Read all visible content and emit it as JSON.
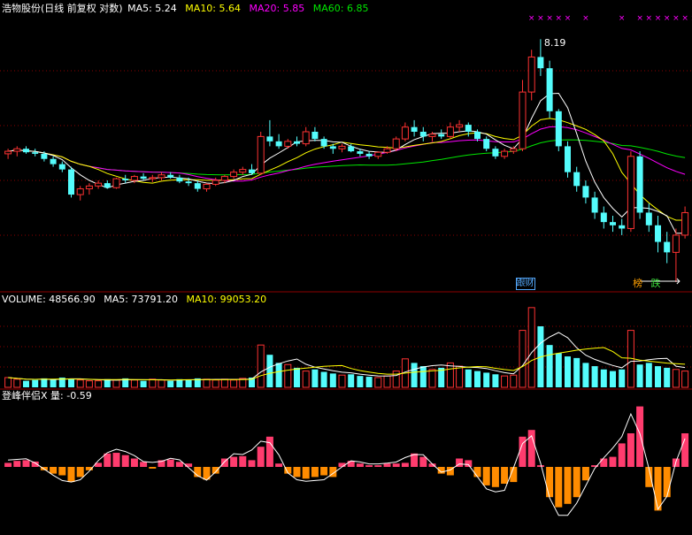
{
  "colors": {
    "background": "#000000",
    "grid": "#8b0000",
    "up": "#ff3232",
    "down": "#54fcfc",
    "text": "#ffffff",
    "ma5": "#ffffff",
    "ma10": "#ffff00",
    "ma20": "#ff00ff",
    "ma60": "#00e600",
    "bar_pos": "#ff3c6e",
    "bar_neg": "#ff8c00",
    "marker_cyan": "#54a8fc",
    "marker_orange": "#ffa000",
    "marker_green": "#3cdc3c",
    "marker_pink": "#ff00ff"
  },
  "price_panel": {
    "title": "浩物股份(日线 前复权 对数)",
    "ma_labels": [
      {
        "key": "MA5",
        "text": "MA5: 5.24"
      },
      {
        "key": "MA10",
        "text": "MA10: 5.64"
      },
      {
        "key": "MA20",
        "text": "MA20: 5.85"
      },
      {
        "key": "MA60",
        "text": "MA60: 6.85"
      }
    ],
    "peak_label": "8.19",
    "markers": [
      {
        "text": "跟财",
        "day": 57
      },
      {
        "text": "榜",
        "day": 70
      },
      {
        "text": "跌",
        "day": 72
      }
    ],
    "pink_x_days": [
      58,
      59,
      60,
      61,
      62,
      64,
      68,
      70,
      71,
      72,
      73,
      74,
      75,
      76,
      77
    ]
  },
  "volume_panel": {
    "labels": [
      {
        "key": "VOLUME",
        "text": "VOLUME: 48566.90"
      },
      {
        "key": "MA5",
        "text": "MA5: 73791.20"
      },
      {
        "key": "MA10",
        "text": "MA10: 99053.20"
      }
    ]
  },
  "indicator_panel": {
    "label": "登峰伴侣X 量: -0.59"
  },
  "chart_data": {
    "type": "candlestick",
    "candles": [
      [
        5.85,
        5.95,
        5.75,
        5.9
      ],
      [
        5.9,
        6.0,
        5.8,
        5.95
      ],
      [
        5.95,
        6.0,
        5.85,
        5.88
      ],
      [
        5.88,
        5.95,
        5.8,
        5.85
      ],
      [
        5.85,
        5.9,
        5.7,
        5.75
      ],
      [
        5.75,
        5.8,
        5.6,
        5.65
      ],
      [
        5.65,
        5.7,
        5.5,
        5.55
      ],
      [
        5.55,
        5.6,
        5.05,
        5.1
      ],
      [
        5.1,
        5.25,
        5.0,
        5.2
      ],
      [
        5.2,
        5.3,
        5.1,
        5.25
      ],
      [
        5.25,
        5.35,
        5.2,
        5.3
      ],
      [
        5.3,
        5.35,
        5.2,
        5.22
      ],
      [
        5.22,
        5.4,
        5.2,
        5.38
      ],
      [
        5.38,
        5.45,
        5.3,
        5.35
      ],
      [
        5.35,
        5.45,
        5.3,
        5.42
      ],
      [
        5.42,
        5.48,
        5.35,
        5.38
      ],
      [
        5.38,
        5.45,
        5.32,
        5.4
      ],
      [
        5.4,
        5.5,
        5.35,
        5.45
      ],
      [
        5.45,
        5.5,
        5.38,
        5.4
      ],
      [
        5.4,
        5.45,
        5.3,
        5.33
      ],
      [
        5.33,
        5.4,
        5.25,
        5.3
      ],
      [
        5.3,
        5.35,
        5.15,
        5.2
      ],
      [
        5.2,
        5.3,
        5.15,
        5.28
      ],
      [
        5.28,
        5.4,
        5.25,
        5.35
      ],
      [
        5.35,
        5.45,
        5.3,
        5.42
      ],
      [
        5.42,
        5.55,
        5.38,
        5.5
      ],
      [
        5.5,
        5.6,
        5.45,
        5.55
      ],
      [
        5.55,
        5.65,
        5.45,
        5.48
      ],
      [
        5.48,
        6.3,
        5.45,
        6.2
      ],
      [
        6.2,
        6.55,
        6.0,
        6.1
      ],
      [
        6.1,
        6.25,
        5.95,
        6.0
      ],
      [
        6.0,
        6.15,
        5.95,
        6.1
      ],
      [
        6.1,
        6.2,
        6.0,
        6.05
      ],
      [
        6.05,
        6.4,
        6.0,
        6.3
      ],
      [
        6.3,
        6.4,
        6.1,
        6.15
      ],
      [
        6.15,
        6.2,
        5.95,
        6.0
      ],
      [
        6.0,
        6.05,
        5.85,
        5.95
      ],
      [
        5.95,
        6.05,
        5.88,
        6.0
      ],
      [
        6.0,
        6.05,
        5.88,
        5.9
      ],
      [
        5.9,
        5.95,
        5.8,
        5.85
      ],
      [
        5.85,
        5.9,
        5.75,
        5.8
      ],
      [
        5.8,
        5.9,
        5.75,
        5.88
      ],
      [
        5.88,
        6.0,
        5.85,
        5.95
      ],
      [
        5.95,
        6.2,
        5.9,
        6.15
      ],
      [
        6.15,
        6.5,
        6.1,
        6.4
      ],
      [
        6.4,
        6.55,
        6.2,
        6.3
      ],
      [
        6.3,
        6.4,
        6.1,
        6.2
      ],
      [
        6.2,
        6.3,
        6.1,
        6.25
      ],
      [
        6.25,
        6.35,
        6.15,
        6.2
      ],
      [
        6.2,
        6.5,
        6.15,
        6.4
      ],
      [
        6.4,
        6.55,
        6.3,
        6.45
      ],
      [
        6.45,
        6.5,
        6.2,
        6.3
      ],
      [
        6.3,
        6.35,
        6.1,
        6.15
      ],
      [
        6.15,
        6.2,
        5.9,
        5.95
      ],
      [
        5.95,
        6.0,
        5.75,
        5.8
      ],
      [
        5.8,
        5.95,
        5.75,
        5.9
      ],
      [
        5.9,
        6.0,
        5.85,
        5.95
      ],
      [
        5.95,
        7.5,
        5.9,
        7.2
      ],
      [
        7.2,
        8.3,
        7.0,
        8.1
      ],
      [
        8.1,
        8.6,
        7.6,
        7.8
      ],
      [
        7.8,
        8.0,
        6.6,
        6.75
      ],
      [
        6.75,
        6.8,
        5.9,
        6.0
      ],
      [
        6.0,
        6.1,
        5.4,
        5.5
      ],
      [
        5.5,
        5.6,
        5.15,
        5.25
      ],
      [
        5.25,
        5.35,
        4.95,
        5.05
      ],
      [
        5.05,
        5.15,
        4.7,
        4.8
      ],
      [
        4.8,
        4.9,
        4.55,
        4.65
      ],
      [
        4.65,
        4.75,
        4.5,
        4.6
      ],
      [
        4.6,
        4.7,
        4.45,
        4.55
      ],
      [
        4.55,
        5.9,
        4.5,
        5.8
      ],
      [
        5.8,
        5.9,
        4.7,
        4.8
      ],
      [
        4.8,
        4.95,
        4.5,
        4.6
      ],
      [
        4.6,
        4.75,
        4.2,
        4.35
      ],
      [
        4.35,
        4.5,
        4.05,
        4.2
      ],
      [
        4.2,
        4.55,
        3.8,
        4.45
      ],
      [
        4.45,
        4.9,
        4.4,
        4.8
      ]
    ],
    "volume": [
      12,
      10,
      8,
      9,
      11,
      10,
      12,
      10,
      9,
      8,
      8,
      10,
      9,
      11,
      9,
      8,
      10,
      9,
      8,
      10,
      9,
      11,
      10,
      9,
      10,
      9,
      11,
      12,
      52,
      40,
      30,
      28,
      24,
      20,
      22,
      19,
      17,
      15,
      16,
      14,
      13,
      12,
      14,
      20,
      35,
      30,
      26,
      22,
      24,
      30,
      26,
      22,
      20,
      18,
      16,
      14,
      15,
      70,
      98,
      75,
      52,
      42,
      38,
      36,
      30,
      26,
      22,
      20,
      22,
      70,
      28,
      30,
      26,
      24,
      22,
      20
    ],
    "indicator": [
      0.12,
      0.18,
      0.2,
      0.16,
      -0.1,
      -0.2,
      -0.25,
      -0.45,
      -0.3,
      -0.1,
      0.12,
      0.4,
      0.42,
      0.35,
      0.25,
      0.15,
      -0.05,
      0.2,
      0.22,
      0.15,
      0.1,
      -0.3,
      -0.38,
      -0.2,
      0.25,
      0.3,
      0.32,
      0.2,
      0.6,
      0.9,
      0.1,
      -0.2,
      -0.3,
      -0.35,
      -0.3,
      -0.25,
      -0.3,
      0.12,
      0.18,
      0.1,
      0.05,
      0.05,
      0.1,
      0.1,
      0.12,
      0.4,
      0.3,
      0.1,
      -0.2,
      -0.25,
      0.25,
      0.2,
      -0.3,
      -0.55,
      -0.6,
      -0.5,
      -0.45,
      0.9,
      1.1,
      0.05,
      -0.9,
      -1.2,
      -1.1,
      -0.9,
      -0.4,
      0.05,
      0.25,
      0.3,
      0.7,
      1.0,
      1.8,
      -0.6,
      -1.3,
      -0.9,
      0.25,
      1.0
    ],
    "ylim_log": [
      3.7,
      9.3
    ]
  }
}
